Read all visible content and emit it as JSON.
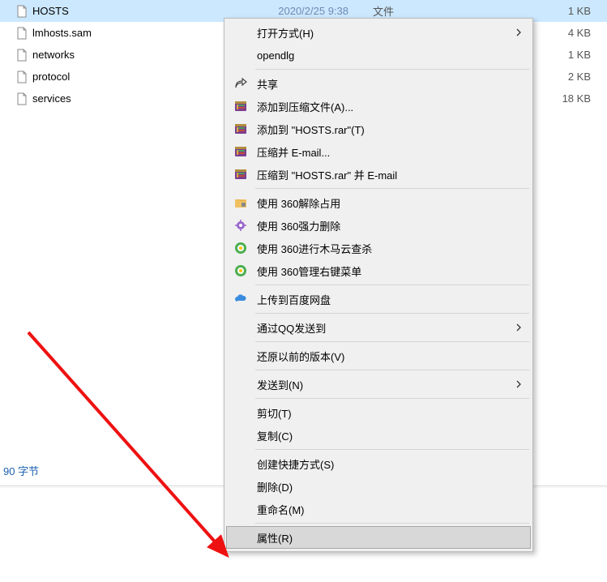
{
  "files": [
    {
      "name": "HOSTS",
      "date": "2020/2/25 9:38",
      "type": "文件",
      "size": "1 KB",
      "selected": true
    },
    {
      "name": "lmhosts.sam",
      "date": "",
      "type": "",
      "size": "4 KB",
      "selected": false
    },
    {
      "name": "networks",
      "date": "",
      "type": "",
      "size": "1 KB",
      "selected": false
    },
    {
      "name": "protocol",
      "date": "",
      "type": "",
      "size": "2 KB",
      "selected": false
    },
    {
      "name": "services",
      "date": "",
      "type": "",
      "size": "18 KB",
      "selected": false
    }
  ],
  "status": "90 字节",
  "menu": {
    "open_with": "打开方式(H)",
    "opendlg": "opendlg",
    "share": "共享",
    "add_archive": "添加到压缩文件(A)...",
    "add_hosts_rar": "添加到 \"HOSTS.rar\"(T)",
    "compress_email": "压缩并 E-mail...",
    "compress_hosts_email": "压缩到 \"HOSTS.rar\" 并 E-mail",
    "use_360_unlock": "使用 360解除占用",
    "use_360_force_delete": "使用 360强力删除",
    "use_360_trojan_scan": "使用 360进行木马云查杀",
    "use_360_manage_menu": "使用 360管理右键菜单",
    "upload_baidu": "上传到百度网盘",
    "send_qq": "通过QQ发送到",
    "restore_prev": "还原以前的版本(V)",
    "send_to": "发送到(N)",
    "cut": "剪切(T)",
    "copy": "复制(C)",
    "create_shortcut": "创建快捷方式(S)",
    "delete": "删除(D)",
    "rename": "重命名(M)",
    "properties": "属性(R)"
  }
}
